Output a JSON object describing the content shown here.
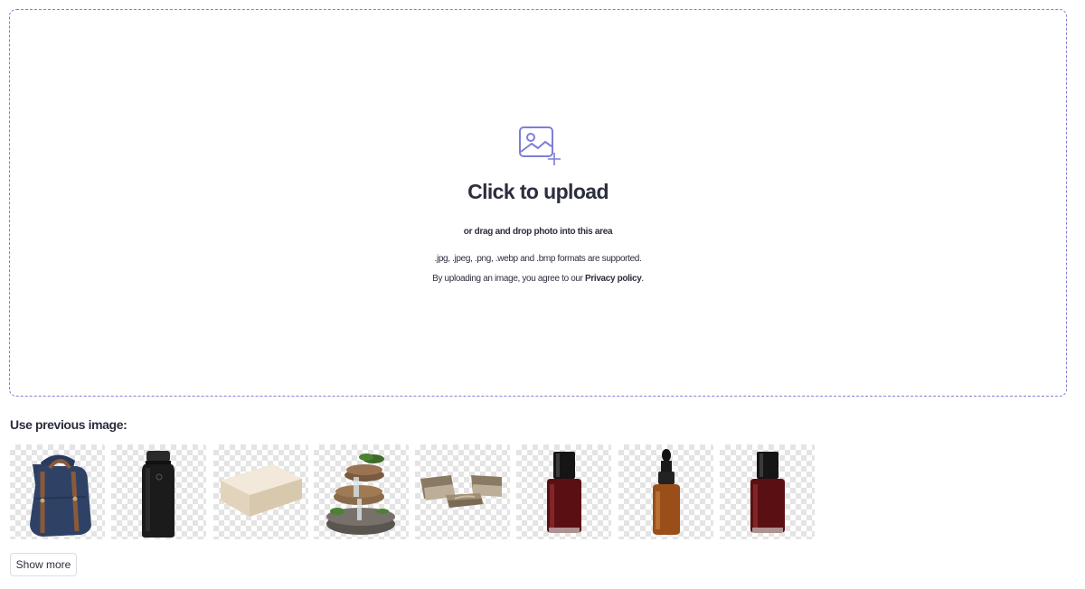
{
  "upload": {
    "icon": "image-add-icon",
    "title": "Click to upload",
    "subtitle": "or drag and drop photo into this area",
    "formats": ".jpg, .jpeg, .png, .webp and .bmp formats are supported.",
    "policy_prefix": "By uploading an image, you agree to our ",
    "policy_link": "Privacy policy",
    "policy_suffix": ".",
    "accent_color": "#7d7fd6"
  },
  "previous": {
    "heading": "Use previous image:",
    "images": [
      {
        "subject": "backpack"
      },
      {
        "subject": "black-bottle"
      },
      {
        "subject": "soap-bar"
      },
      {
        "subject": "stone-fountain"
      },
      {
        "subject": "patio-furniture"
      },
      {
        "subject": "nail-polish"
      },
      {
        "subject": "dropper-bottle"
      },
      {
        "subject": "nail-polish"
      }
    ],
    "show_more_label": "Show more"
  }
}
